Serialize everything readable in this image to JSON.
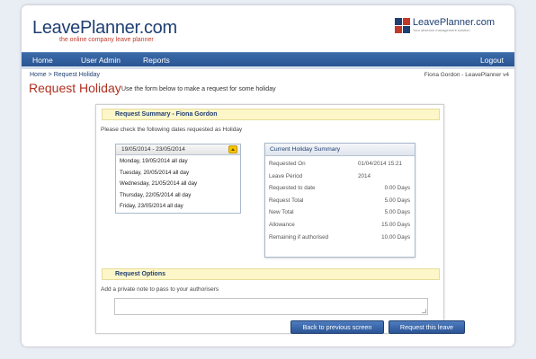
{
  "header": {
    "logo_brand": "LeavePlanner.com",
    "logo_tagline": "the online company leave planner",
    "right_logo_brand": "LeavePlanner.com",
    "right_logo_tagline": "Your absence management solution"
  },
  "nav": {
    "home": "Home",
    "user_admin": "User Admin",
    "reports": "Reports",
    "logout": "Logout"
  },
  "breadcrumb": {
    "home": "Home",
    "separator": ">",
    "current": "Request Holiday"
  },
  "user_line": "Fiona Gordon - LeavePlanner v4",
  "page": {
    "title": "Request Holiday",
    "subtitle": "Use the form below to make a request for some holiday"
  },
  "summary_section": {
    "heading": "Request Summary - Fiona Gordon",
    "instruction": "Please check the following dates requested as Holiday"
  },
  "dates": {
    "range": "19/05/2014 - 23/05/2014",
    "items": [
      "Monday, 19/05/2014 all day",
      "Tuesday, 20/05/2014 all day",
      "Wednesday, 21/05/2014 all day",
      "Thursday, 22/05/2014 all day",
      "Friday, 23/05/2014 all day"
    ]
  },
  "holiday_summary": {
    "title": "Current Holiday Summary",
    "rows": [
      {
        "label": "Requested On",
        "value": "01/04/2014 15:21"
      },
      {
        "label": "Leave Period",
        "value": "2014"
      },
      {
        "label": "Requested to date",
        "value": "0.00 Days"
      },
      {
        "label": "Request Total",
        "value": "5.00 Days"
      },
      {
        "label": "New Total",
        "value": "5.00 Days"
      },
      {
        "label": "Allowance",
        "value": "15.00 Days"
      },
      {
        "label": "Remaining if authorised",
        "value": "10.00 Days"
      }
    ]
  },
  "options_section": {
    "heading": "Request Options",
    "note_label": "Add a private note to pass to your authorisers",
    "note_value": ""
  },
  "buttons": {
    "back": "Back to previous screen",
    "request": "Request this leave"
  },
  "colors": {
    "brand_blue": "#1f3f73",
    "accent_red": "#b03020",
    "nav_blue": "#2a5593",
    "section_yellow": "#fdf6c8"
  }
}
